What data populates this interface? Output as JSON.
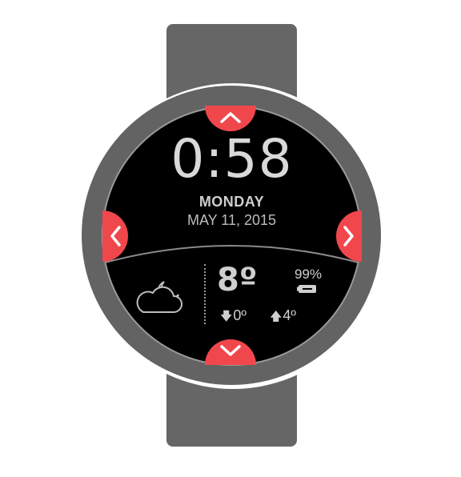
{
  "watch": {
    "time": "0:58",
    "day": "MONDAY",
    "date": "MAY 11, 2015"
  },
  "weather": {
    "icon": "partly-cloudy-night-icon",
    "current_temp": "8º",
    "low": "0º",
    "high": "4º"
  },
  "battery": {
    "percent": "99%",
    "icon": "battery-icon"
  },
  "colors": {
    "accent": "#f0474d",
    "strap": "#666666",
    "bezel": "#636363",
    "face": "#000000",
    "text": "#cfcfcf"
  },
  "navigation": {
    "up": "chevron-up-icon",
    "down": "chevron-down-icon",
    "left": "chevron-left-icon",
    "right": "chevron-right-icon"
  }
}
